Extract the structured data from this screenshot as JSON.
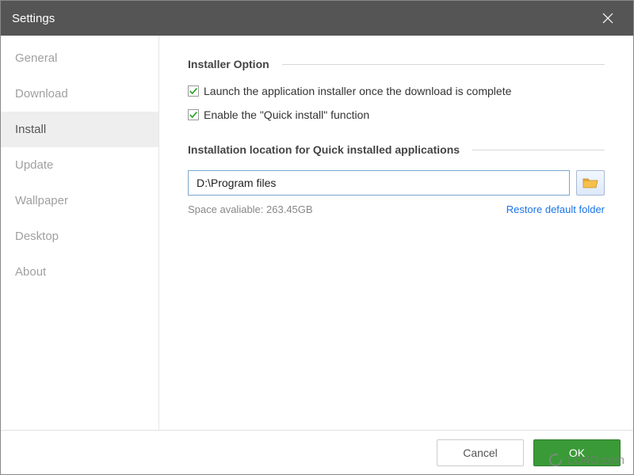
{
  "titlebar": {
    "title": "Settings"
  },
  "sidebar": {
    "items": [
      {
        "label": "General",
        "selected": false
      },
      {
        "label": "Download",
        "selected": false
      },
      {
        "label": "Install",
        "selected": true
      },
      {
        "label": "Update",
        "selected": false
      },
      {
        "label": "Wallpaper",
        "selected": false
      },
      {
        "label": "Desktop",
        "selected": false
      },
      {
        "label": "About",
        "selected": false
      }
    ]
  },
  "content": {
    "section1_title": "Installer Option",
    "checkbox1_label": "Launch the application installer once the download is complete",
    "checkbox1_checked": true,
    "checkbox2_label": "Enable the \"Quick install\" function",
    "checkbox2_checked": true,
    "section2_title": "Installation location for Quick installed applications",
    "install_path": "D:\\Program files",
    "space_label": "Space avaliable: 263.45GB",
    "restore_label": "Restore default folder"
  },
  "footer": {
    "cancel_label": "Cancel",
    "ok_label": "OK"
  },
  "watermark": {
    "text": "LO4D.com"
  }
}
